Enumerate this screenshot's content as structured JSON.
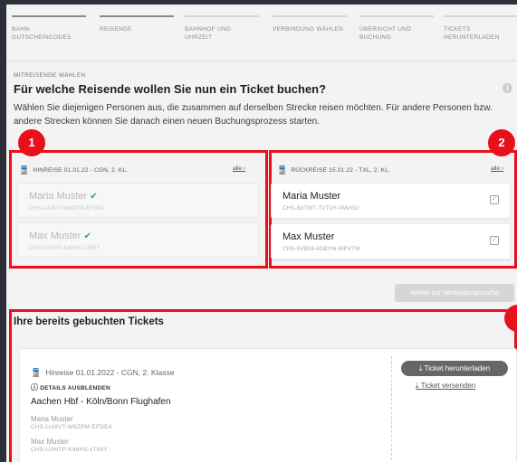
{
  "stepper": {
    "steps": [
      {
        "label": "Bahn-Gutscheincodes",
        "state": "done"
      },
      {
        "label": "Reisende",
        "state": "done"
      },
      {
        "label": "Bahnhof und Uhrzeit",
        "state": "open"
      },
      {
        "label": "Verbindung wählen",
        "state": "open"
      },
      {
        "label": "Übersicht und Buchung",
        "state": "open"
      },
      {
        "label": "Tickets herunterladen",
        "state": "open"
      }
    ]
  },
  "section": {
    "eyebrow": "MITREISENDE WÄHLEN",
    "title": "Für welche Reisende wollen Sie nun ein Ticket buchen?",
    "info_icon": "info-icon",
    "intro": "Wählen Sie diejenigen Personen aus, die zusammen auf derselben Strecke reisen möchten. Für andere Personen bzw. andere Strecken können Sie danach einen neuen Buchungsprozess starten."
  },
  "annotations": {
    "badge_1": "1",
    "badge_2": "2",
    "color": "#e8101c"
  },
  "outbound": {
    "icon": "train-icon",
    "title": "HINREISE 01.01.22 - CGN, 2. KL.",
    "all_link": "alle",
    "passengers": [
      {
        "name": "Maria Muster",
        "id": "CHS-UA8VT-W6ZPM-EFDE4",
        "selected": true
      },
      {
        "name": "Max Muster",
        "id": "CHS-U3HTP-K48HS-LT69Y",
        "selected": true
      }
    ]
  },
  "return": {
    "icon": "train-icon",
    "title": "RÜCKREISE 15.01.22 - TXL, 2. KL.",
    "all_link": "alle",
    "passengers": [
      {
        "name": "Maria Muster",
        "id": "CHS-8GTW7-TVTUY-VMVGU",
        "selected": false
      },
      {
        "name": "Max Muster",
        "id": "CHS-8VBX6-4DBYW-WPVTW",
        "selected": false
      }
    ]
  },
  "continue_button": "Weiter zur Verbindungssuche",
  "booked": {
    "title": "Ihre bereits gebuchten Tickets",
    "ticket": {
      "trip": "Hinreise 01.01.2022 - CGN, 2. Klasse",
      "details_toggle": "DETAILS AUSBLENDEN",
      "route": "Aachen Hbf - Köln/Bonn Flughafen",
      "passengers": [
        {
          "name": "Maria Muster",
          "id": "CHS-UA8VT-W6ZPM-EFDE4"
        },
        {
          "name": "Max Muster",
          "id": "CHS-U3HTP-K48HS-LT69Y"
        }
      ],
      "download_button": "Ticket herunterladen",
      "send_link": "Ticket versenden"
    }
  }
}
